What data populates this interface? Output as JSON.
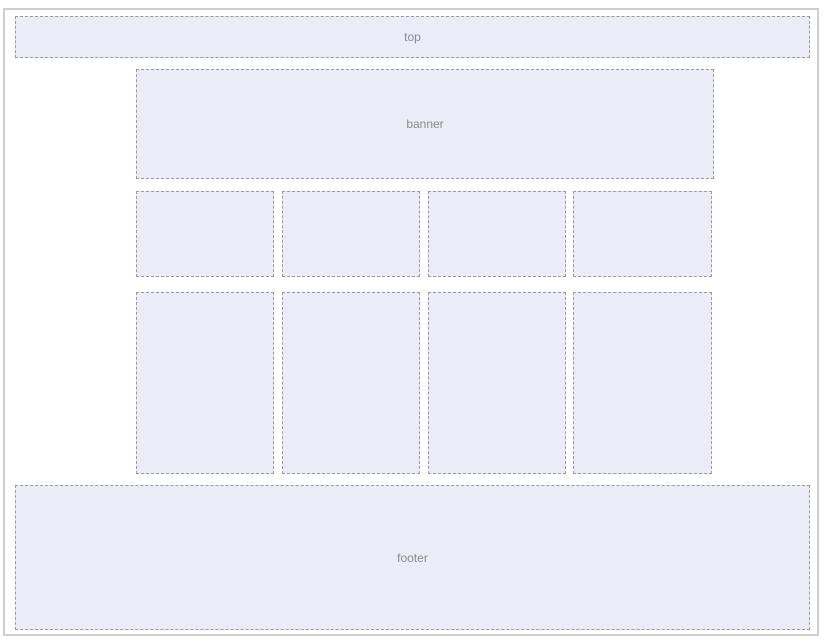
{
  "regions": {
    "top": {
      "label": "top"
    },
    "banner": {
      "label": "banner"
    },
    "footer": {
      "label": "footer"
    },
    "row1": [
      "",
      "",
      "",
      ""
    ],
    "row2": [
      "",
      "",
      "",
      ""
    ]
  },
  "colors": {
    "box_fill": "#ececf8",
    "box_border": "#9a9a9a",
    "frame_border": "#cfcfcf",
    "label_text": "#8c8c8c"
  }
}
